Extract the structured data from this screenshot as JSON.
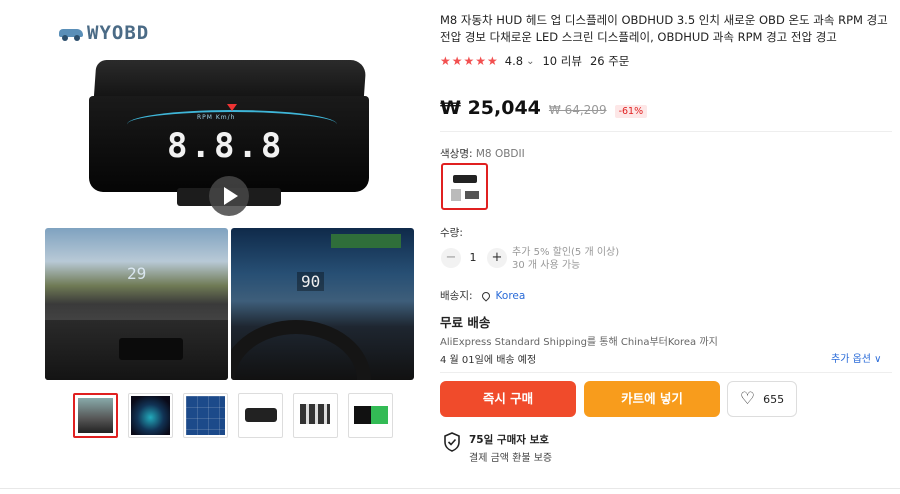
{
  "gallery": {
    "logo_text": "WYOBD",
    "main_image_digits": "8.8.8",
    "main_image_hud_label": "RPM    Km/h",
    "sub_image_1_speed": "29",
    "sub_image_2_speed": "90",
    "thumbnails_count": 6,
    "selected_thumbnail": 1
  },
  "product": {
    "title": "M8 자동차 HUD 헤드 업 디스플레이 OBDHUD 3.5 인치 새로운 OBD 온도 과속 RPM 경고 전압 경보 다채로운 LED 스크린 디스플레이, OBDHUD 과속 RPM 경고 전압 경고",
    "rating": "4.8",
    "reviews": "10 리뷰",
    "orders": "26 주문",
    "star_color": "#f25050"
  },
  "price": {
    "current": "₩ 25,044",
    "original": "₩ 64,209",
    "discount": "-61%"
  },
  "variant": {
    "label": "색상명:",
    "value": "M8 OBDII"
  },
  "quantity": {
    "label": "수량:",
    "value": "1",
    "minus": "−",
    "plus": "+",
    "note_line1": "추가 5% 할인(5 개 이상)",
    "note_line2": "30 개 사용 가능"
  },
  "shipping": {
    "to_label": "배송지:",
    "destination": "Korea",
    "title": "무료 배송",
    "detail": "AliExpress Standard Shipping를 통해 China부터Korea 까지",
    "date": "4 월 01일에 배송 예정",
    "more_options": "추가 옵션 ∨"
  },
  "actions": {
    "buy_now": "즉시 구매",
    "add_to_cart": "카트에 넣기",
    "wishlist_count": "655",
    "buy_color": "#f04b2b",
    "cart_color": "#f89c1c"
  },
  "protection": {
    "title": "75일 구매자 보호",
    "subtitle": "결제 금액 환불 보증"
  }
}
